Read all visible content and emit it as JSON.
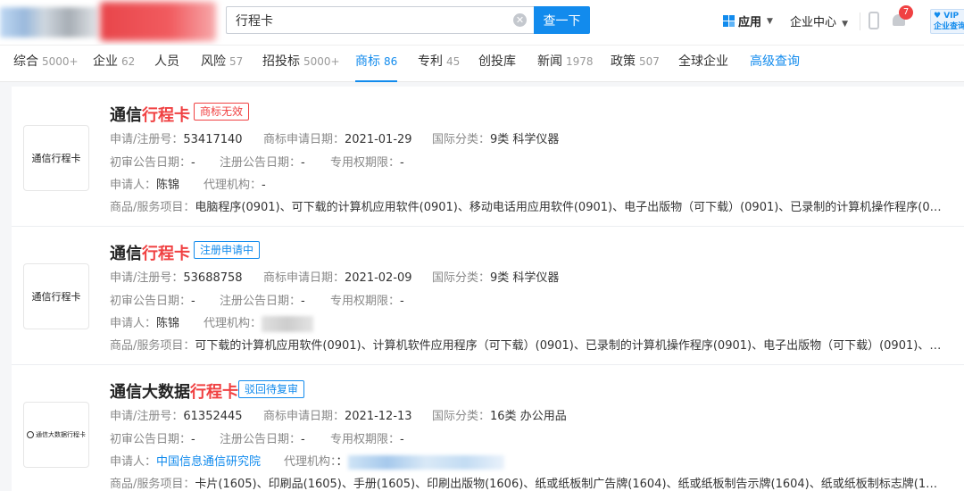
{
  "search": {
    "query": "行程卡",
    "button_label": "查一下"
  },
  "header": {
    "apps_label": "应用",
    "enterprise_center_label": "企业中心",
    "notification_count": "7",
    "vip_line1": "VIP",
    "vip_line2": "企业查询"
  },
  "tabs": [
    {
      "label": "综合",
      "count": "5000+"
    },
    {
      "label": "企业",
      "count": "62"
    },
    {
      "label": "人员",
      "count": ""
    },
    {
      "label": "风险",
      "count": "57"
    },
    {
      "label": "招投标",
      "count": "5000+"
    },
    {
      "label": "商标",
      "count": "86"
    },
    {
      "label": "专利",
      "count": "45"
    },
    {
      "label": "创投库",
      "count": ""
    },
    {
      "label": "新闻",
      "count": "1978"
    },
    {
      "label": "政策",
      "count": "507"
    },
    {
      "label": "全球企业",
      "count": ""
    },
    {
      "label": "高级查询",
      "count": ""
    }
  ],
  "labels": {
    "reg_no": "申请/注册号：",
    "apply_date": "商标申请日期：",
    "intl_class": "国际分类：",
    "prelim_date": "初审公告日期：",
    "reg_date": "注册公告日期：",
    "exclusive_period": "专用权期限：",
    "applicant": "申请人：",
    "agent": "代理机构：",
    "goods": "商品/服务项目："
  },
  "results": [
    {
      "thumb_text": "通信行程卡",
      "title_prefix": "通信",
      "title_highlight": "行程卡",
      "status": "商标无效",
      "reg_no": "53417140",
      "apply_date": "2021-01-29",
      "intl_class": "9类 科学仪器",
      "prelim_date": "-",
      "reg_date": "-",
      "exclusive_period": "-",
      "applicant": "陈锦",
      "agent": "-",
      "goods": "电脑程序(0901)、可下载的计算机应用软件(0901)、移动电话用应用软件(0901)、电子出版物（可下载）(0901)、已录制的计算机操作程序(090..."
    },
    {
      "thumb_text": "通信行程卡",
      "title_prefix": "通信",
      "title_highlight": "行程卡",
      "status": "注册申请中",
      "reg_no": "53688758",
      "apply_date": "2021-02-09",
      "intl_class": "9类 科学仪器",
      "prelim_date": "-",
      "reg_date": "-",
      "exclusive_period": "-",
      "applicant": "陈锦",
      "agent": "",
      "goods": "可下载的计算机应用软件(0901)、计算机软件应用程序（可下载）(0901)、已录制的计算机操作程序(0901)、电子出版物（可下载）(0901)、可..."
    },
    {
      "thumb_text": "通信大数据行程卡",
      "title_prefix": "通信大数据",
      "title_highlight": "行程卡",
      "status": "驳回待复审",
      "reg_no": "61352445",
      "apply_date": "2021-12-13",
      "intl_class": "16类 办公用品",
      "prelim_date": "-",
      "reg_date": "-",
      "exclusive_period": "-",
      "applicant": "中国信息通信研究院",
      "agent": "：",
      "goods": "卡片(1605)、印刷品(1605)、手册(1605)、印刷出版物(1606)、纸或纸板制广告牌(1604)、纸或纸板制告示牌(1604)、纸或纸板制标志牌(1604)..."
    }
  ]
}
